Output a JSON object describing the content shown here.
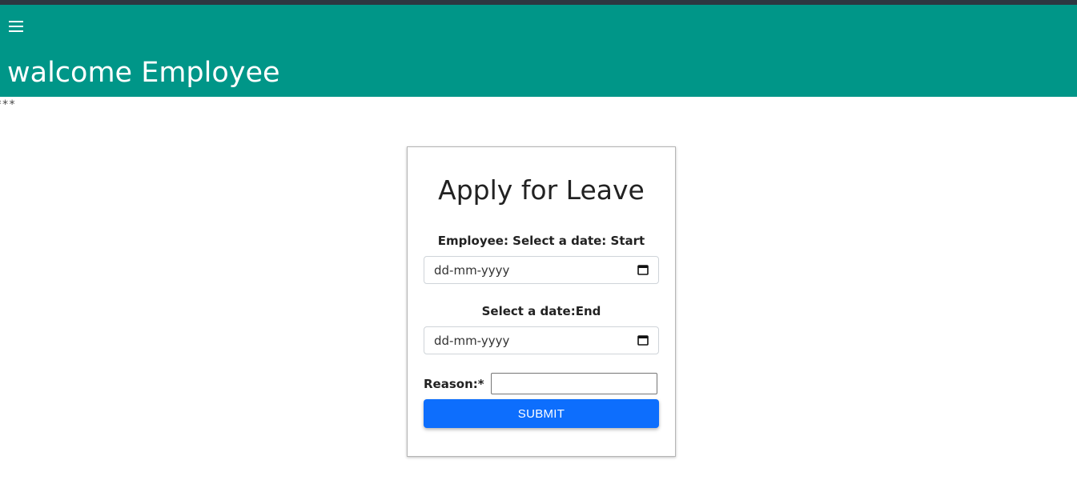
{
  "header": {
    "title": "walcome Employee",
    "menu_glyph": "☰",
    "background": "#009688"
  },
  "stray_text": "***",
  "form": {
    "title": "Apply for Leave",
    "start_label": "Employee: Select a date: Start",
    "start_placeholder": "dd-mm-yyyy",
    "end_label": "Select a date:End",
    "end_placeholder": "dd-mm-yyyy",
    "reason_label": "Reason:*",
    "reason_value": "",
    "submit_label": "SUBMIT",
    "submit_color": "#0d6efd"
  },
  "icons": {
    "menu": "hamburger-menu-icon",
    "calendar": "calendar-icon"
  }
}
